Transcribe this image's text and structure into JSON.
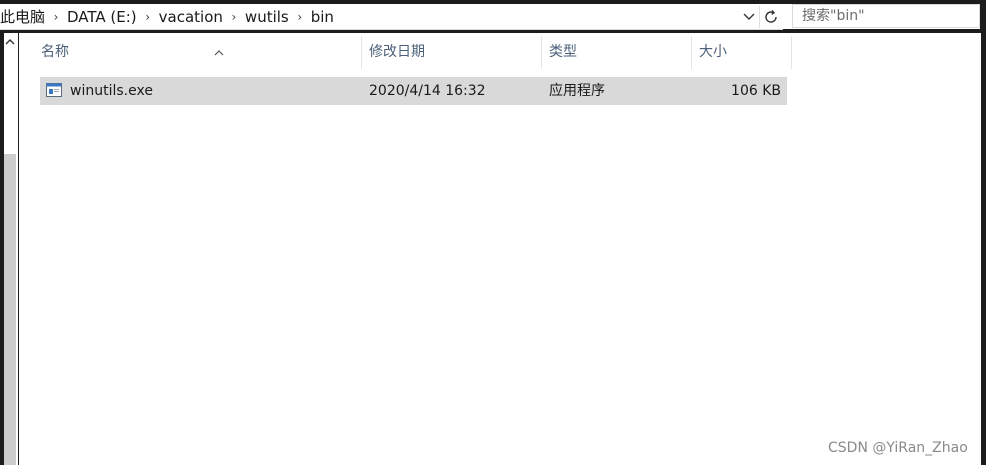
{
  "breadcrumb": {
    "items": [
      {
        "label": "此电脑"
      },
      {
        "label": "DATA (E:)"
      },
      {
        "label": "vacation"
      },
      {
        "label": "wutils"
      },
      {
        "label": "bin"
      }
    ],
    "separator": "›"
  },
  "search": {
    "placeholder": "搜索\"bin\""
  },
  "columns": {
    "name": "名称",
    "modified": "修改日期",
    "type": "类型",
    "size": "大小"
  },
  "files": [
    {
      "name": "winutils.exe",
      "modified": "2020/4/14 16:32",
      "type": "应用程序",
      "size": "106 KB",
      "icon": "exe-icon",
      "selected": true
    }
  ],
  "watermark": "CSDN @YiRan_Zhao",
  "colors": {
    "header_text": "#4c607a",
    "selected_row": "#d9d9d9",
    "window_background": "#ffffff"
  },
  "icons": {
    "dropdown": "chevron-down-icon",
    "refresh": "refresh-icon",
    "nav_up": "scroll-up-icon",
    "sort": "sort-ascending-icon"
  }
}
